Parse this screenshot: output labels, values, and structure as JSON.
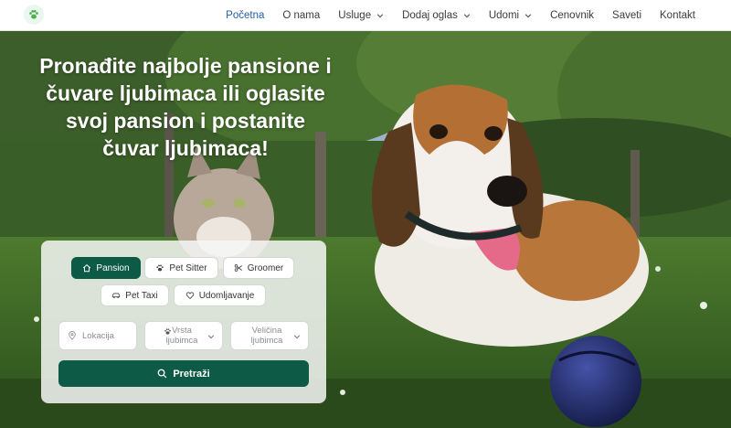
{
  "nav": {
    "items": [
      {
        "label": "Početna",
        "active": true,
        "dropdown": false
      },
      {
        "label": "O nama",
        "active": false,
        "dropdown": false
      },
      {
        "label": "Usluge",
        "active": false,
        "dropdown": true
      },
      {
        "label": "Dodaj oglas",
        "active": false,
        "dropdown": true
      },
      {
        "label": "Udomi",
        "active": false,
        "dropdown": true
      },
      {
        "label": "Cenovnik",
        "active": false,
        "dropdown": false
      },
      {
        "label": "Saveti",
        "active": false,
        "dropdown": false
      },
      {
        "label": "Kontakt",
        "active": false,
        "dropdown": false
      }
    ]
  },
  "hero": {
    "headline": "Pronađite najbolje pansione i čuvare ljubimaca ili oglasite svoj pansion i postanite čuvar ljubimaca!"
  },
  "search": {
    "services": [
      {
        "label": "Pansion",
        "icon": "house-icon",
        "selected": true
      },
      {
        "label": "Pet Sitter",
        "icon": "paw-icon",
        "selected": false
      },
      {
        "label": "Groomer",
        "icon": "scissors-icon",
        "selected": false
      },
      {
        "label": "Pet Taxi",
        "icon": "car-icon",
        "selected": false
      },
      {
        "label": "Udomljavanje",
        "icon": "heart-icon",
        "selected": false
      }
    ],
    "location_placeholder": "Lokacija",
    "pet_type_placeholder": "Vrsta ljubimca",
    "pet_size_placeholder": "Veličina ljubimca",
    "submit_label": "Pretraži"
  },
  "colors": {
    "primary": "#0d5a46",
    "nav_active": "#1f5fa8"
  }
}
